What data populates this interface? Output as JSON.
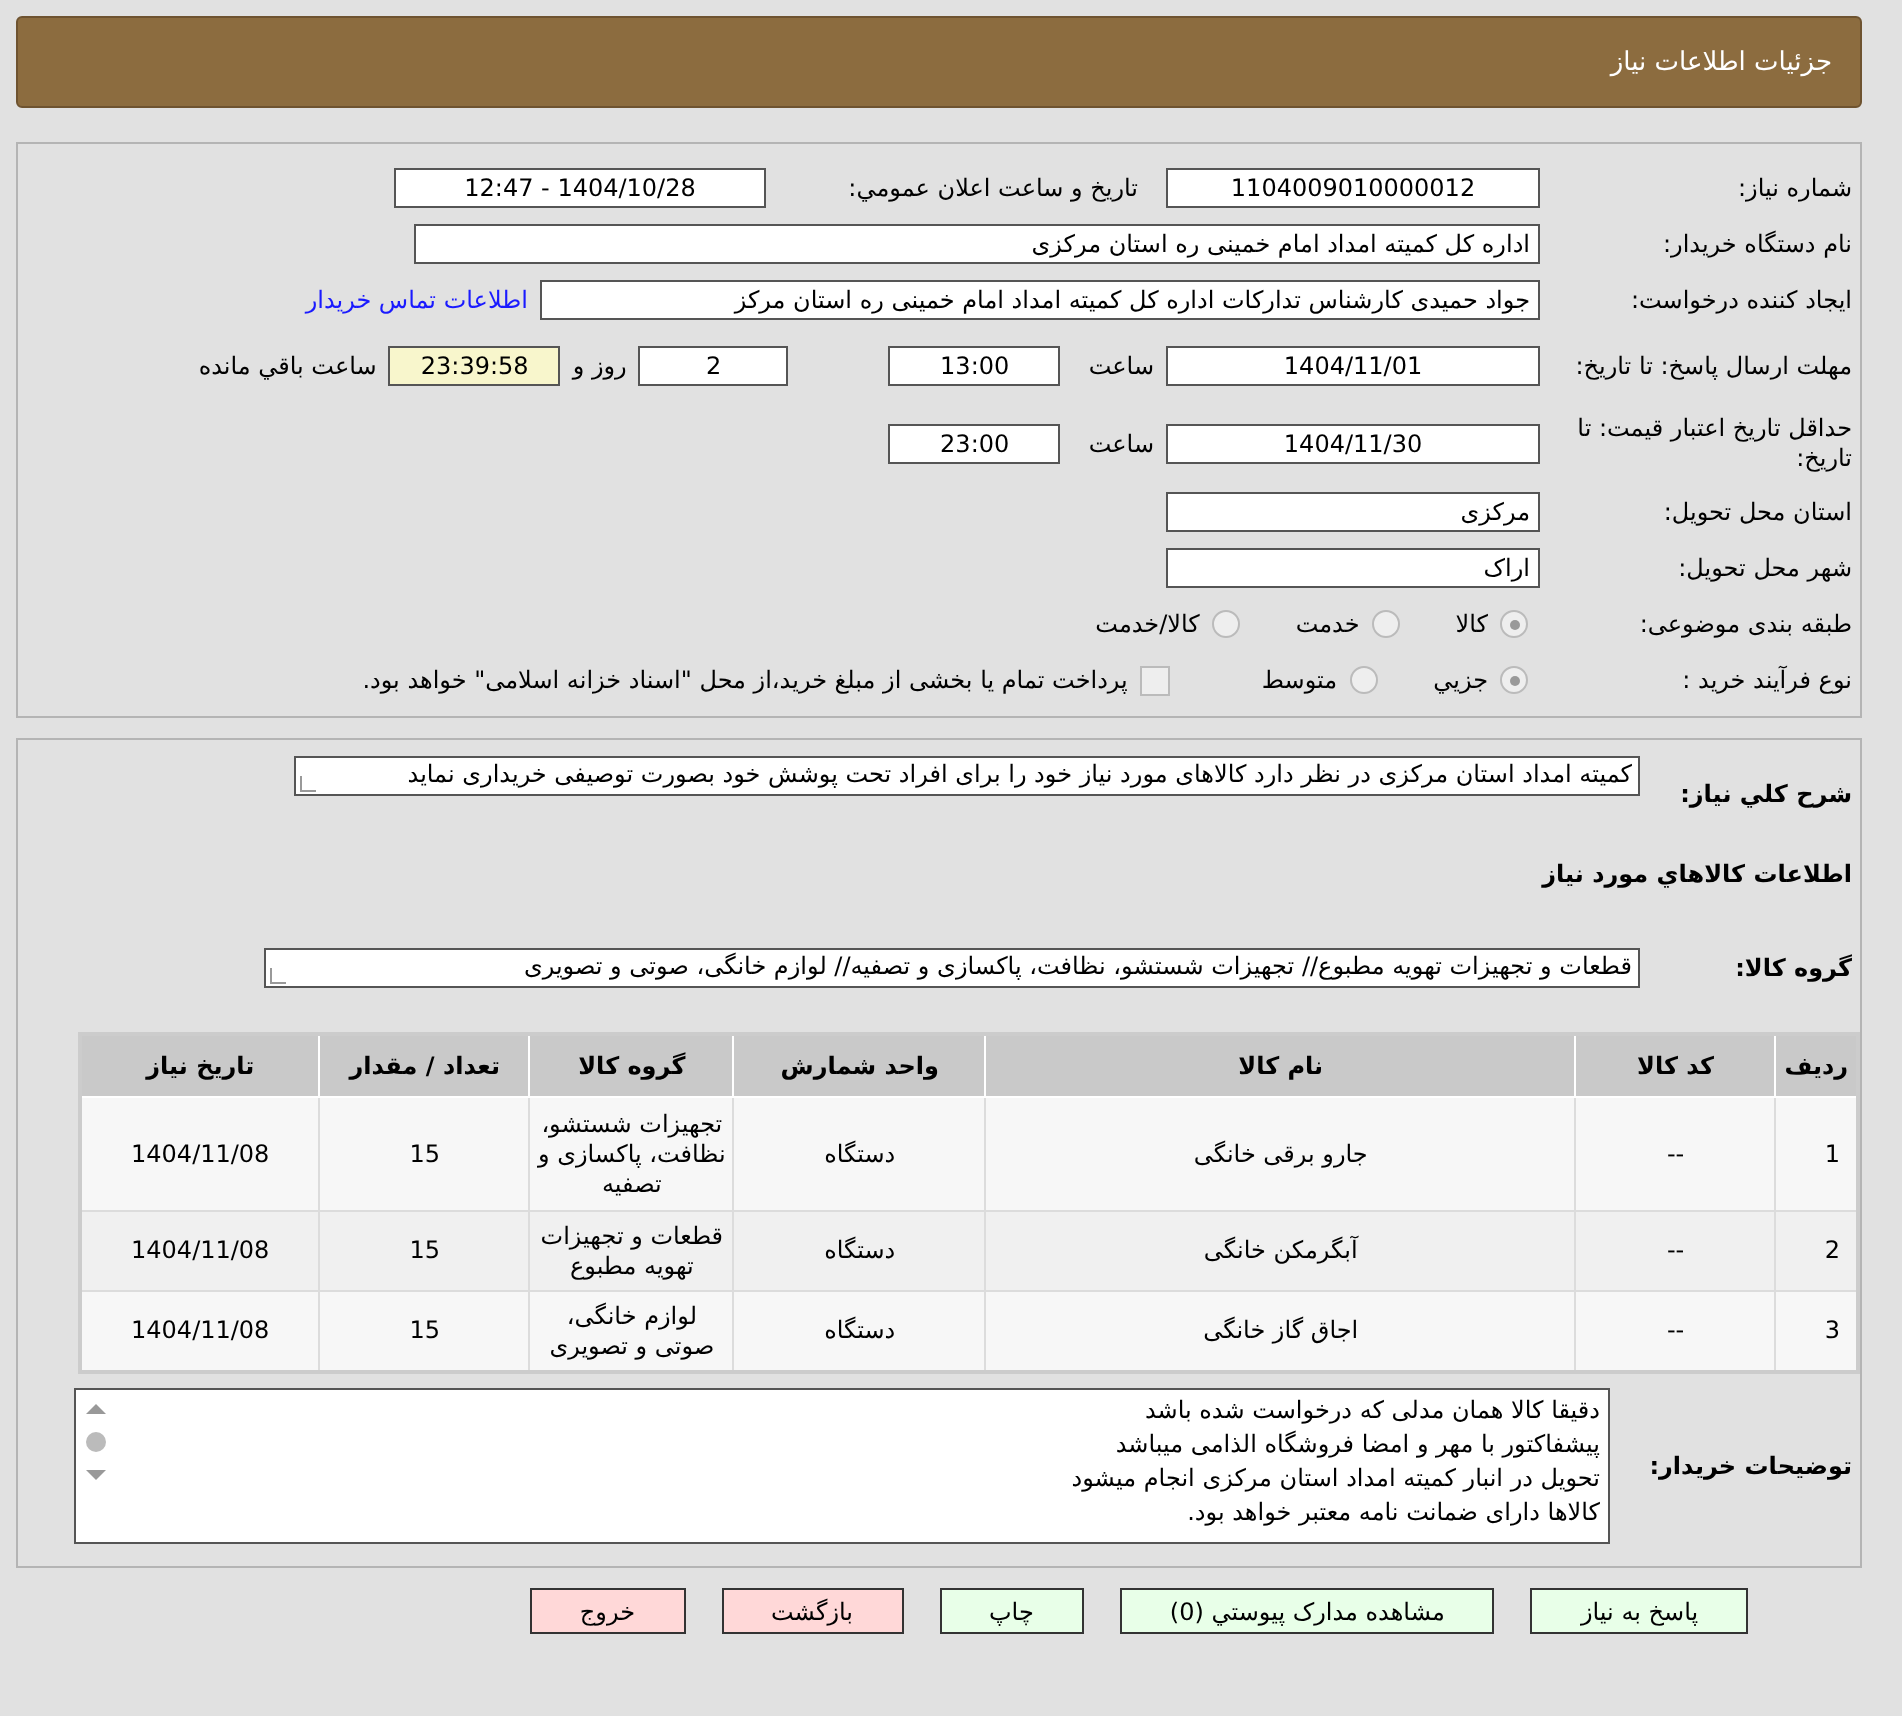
{
  "header": {
    "title": "جزئیات اطلاعات نیاز"
  },
  "need_number": {
    "label": "شماره نیاز:",
    "value": "1104009010000012"
  },
  "announce": {
    "label": "تاریخ و ساعت اعلان عمومي:",
    "value": "1404/10/28 - 12:47"
  },
  "buyer_org": {
    "label": "نام دستگاه خریدار:",
    "value": "اداره کل کمیته امداد امام خمینی  ره  استان مرکزی"
  },
  "requester": {
    "label": "ایجاد کننده درخواست:",
    "value": "جواد حمیدی کارشناس تدارکات اداره کل کمیته امداد امام خمینی  ره  استان مرکز",
    "link": "اطلاعات تماس خریدار"
  },
  "deadline": {
    "label": "مهلت ارسال پاسخ: تا تاریخ:",
    "date": "1404/11/01",
    "time_label": "ساعت",
    "time": "13:00",
    "days": "2",
    "days_label": "روز و",
    "remaining": "23:39:58",
    "remaining_label": "ساعت باقي مانده"
  },
  "validity": {
    "label": "حداقل تاریخ اعتبار قیمت: تا تاریخ:",
    "date": "1404/11/30",
    "time_label": "ساعت",
    "time": "23:00"
  },
  "province": {
    "label": "استان محل تحویل:",
    "value": "مرکزی"
  },
  "city": {
    "label": "شهر محل تحویل:",
    "value": "اراک"
  },
  "category": {
    "label": "طبقه بندی موضوعی:",
    "options": [
      {
        "label": "کالا",
        "selected": true
      },
      {
        "label": "خدمت",
        "selected": false
      },
      {
        "label": "کالا/خدمت",
        "selected": false
      }
    ]
  },
  "process": {
    "label": "نوع فرآیند خرید :",
    "options": [
      {
        "label": "جزيي",
        "selected": true
      },
      {
        "label": "متوسط",
        "selected": false
      }
    ],
    "checkbox": {
      "label": "پرداخت تمام یا بخشی از مبلغ خرید،از محل \"اسناد خزانه اسلامی\" خواهد بود.",
      "checked": false
    }
  },
  "description": {
    "label": "شرح کلي نیاز:",
    "value": "کمیته امداد استان مرکزی در نظر دارد کالاهای مورد نیاز خود را برای افراد تحت پوشش خود بصورت توصیفی خریداری نماید"
  },
  "goods_title": "اطلاعات کالاهاي مورد نیاز",
  "group": {
    "label": "گروه کالا:",
    "value": "قطعات و تجهیزات تهویه مطبوع// تجهیزات شستشو، نظافت، پاکسازی و تصفیه// لوازم خانگی، صوتی و تصویری"
  },
  "table": {
    "columns": [
      "ردیف",
      "کد کالا",
      "نام کالا",
      "واحد شمارش",
      "گروه کالا",
      "تعداد / مقدار",
      "تاریخ نیاز"
    ],
    "rows": [
      [
        "1",
        "--",
        "جارو برقی خانگی",
        "دستگاه",
        "تجهیزات شستشو، نظافت، پاکسازی و تصفیه",
        "15",
        "1404/11/08"
      ],
      [
        "2",
        "--",
        "آبگرمکن خانگی",
        "دستگاه",
        "قطعات و تجهیزات تهویه مطبوع",
        "15",
        "1404/11/08"
      ],
      [
        "3",
        "--",
        "اجاق گاز خانگی",
        "دستگاه",
        "لوازم خانگی، صوتی و تصویری",
        "15",
        "1404/11/08"
      ]
    ]
  },
  "notes": {
    "label": "توضیحات خریدار:",
    "lines": [
      "دقیقا کالا همان مدلی که درخواست شده باشد",
      "پیشفاکتور با مهر و امضا فروشگاه الذامی میباشد",
      "تحویل در انبار کمیته امداد استان مرکزی انجام میشود",
      "کالاها دارای ضمانت نامه معتبر خواهد بود."
    ]
  },
  "buttons": [
    {
      "label": "پاسخ به نیاز",
      "kind": "green"
    },
    {
      "label": "مشاهده مدارک پیوستي (0)",
      "kind": "green"
    },
    {
      "label": "چاپ",
      "kind": "green"
    },
    {
      "label": "بازگشت",
      "kind": "red"
    },
    {
      "label": "خروج",
      "kind": "red"
    }
  ]
}
